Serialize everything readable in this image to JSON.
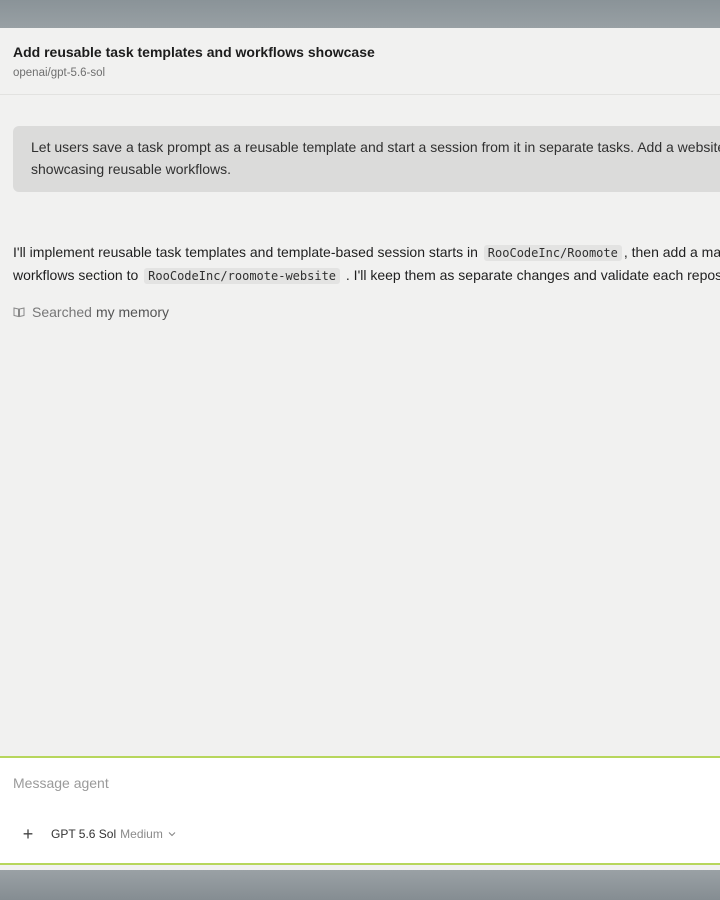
{
  "header": {
    "title": "Add reusable task templates and workflows showcase",
    "model_id": "openai/gpt-5.6-sol"
  },
  "user_message": {
    "line1": "Let users save a task prompt as a reusable template and start a session from it in separate tasks. Add a website section",
    "line2": "showcasing reusable workflows."
  },
  "agent_message": {
    "line1_a": "I'll implement reusable task templates and template-based session starts in",
    "code1": "RooCodeInc/Roomote",
    "line1_b": ", then add a matching",
    "line2_a": "workflows section to",
    "code2": "RooCodeInc/roomote-website",
    "line2_b": ". I'll keep them as separate changes and validate each repository."
  },
  "activity": {
    "action": "Searched",
    "target": "my memory",
    "icon": "book-icon"
  },
  "composer": {
    "placeholder": "Message agent",
    "model_name": "GPT 5.6 Sol",
    "effort": "Medium",
    "add_icon": "plus-icon",
    "dropdown_icon": "chevron-down-icon"
  },
  "colors": {
    "accent_border": "#b7d65c",
    "background": "#f1f1f0",
    "bubble": "#dbdbda"
  }
}
